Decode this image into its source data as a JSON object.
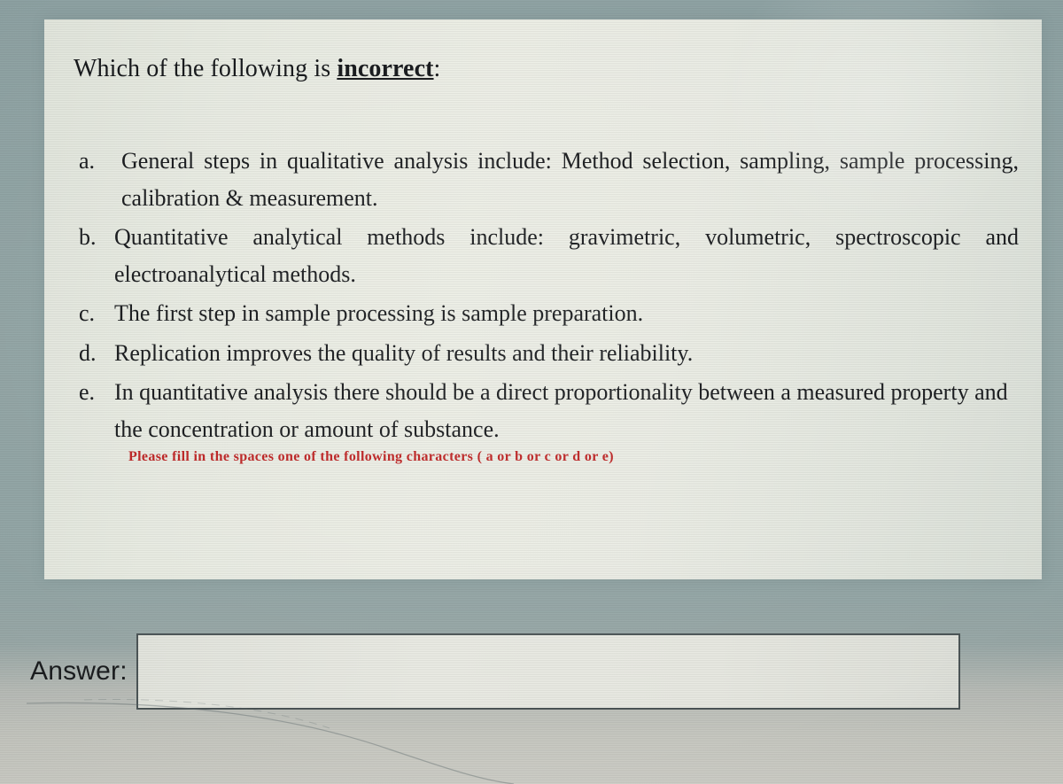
{
  "question": {
    "stem_prefix": "Which of the following is ",
    "stem_emphasis": "incorrect",
    "stem_suffix": ":"
  },
  "options": [
    {
      "marker": "a.",
      "text": "General steps in qualitative analysis include: Method selection, sampling, sample processing, calibration & measurement."
    },
    {
      "marker": "b.",
      "text": "Quantitative analytical methods include: gravimetric, volumetric, spectroscopic and electroanalytical methods."
    },
    {
      "marker": "c.",
      "text": "The first step in sample processing is sample preparation."
    },
    {
      "marker": "d.",
      "text": "Replication improves the quality of results and their reliability."
    },
    {
      "marker": "e.",
      "text": "In quantitative analysis there should be a direct proportionality between a measured property and the concentration or amount of substance."
    }
  ],
  "instruction_note": "Please fill in the spaces one of the following characters ( a or b or c or d or e)",
  "answer": {
    "label": "Answer:",
    "value": "",
    "placeholder": ""
  },
  "colors": {
    "page_background": "#93a6a6",
    "panel_background": "#ecefe6",
    "text": "#17191c",
    "instruction_red": "#c02424",
    "input_border": "#4c5557",
    "input_fill": "#e8eae3"
  }
}
